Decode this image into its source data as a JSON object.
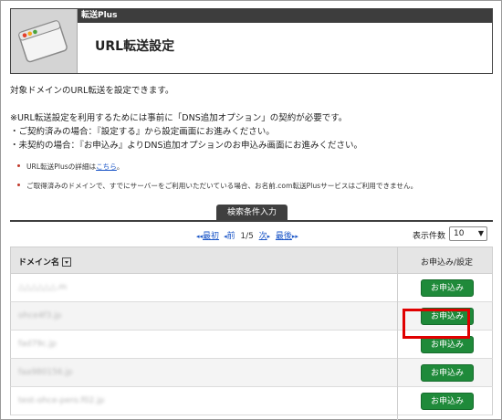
{
  "header": {
    "service_name": "転送Plus",
    "title": "URL転送設定"
  },
  "intro": "対象ドメインのURL転送を設定できます。",
  "requirement": {
    "line1": "※URL転送設定を利用するためには事前に「DNS追加オプション」の契約が必要です。",
    "line2": "・ご契約済みの場合：『設定する』から設定画面にお進みください。",
    "line3": "・未契約の場合：『お申込み』よりDNS追加オプションのお申込み画面にお進みください。"
  },
  "notes": {
    "note1_prefix": "URL転送Plusの詳細は",
    "note1_link": "こちら",
    "note1_suffix": "。",
    "note2": "ご取得済みのドメインで、すでにサーバーをご利用いただいている場合、お名前.com転送Plusサービスはご利用できません。"
  },
  "search_tab": "検索条件入力",
  "pager": {
    "first": "最初",
    "prev": "前",
    "page": "1/5",
    "next": "次",
    "last": "最後"
  },
  "count": {
    "label": "表示件数",
    "value": "10"
  },
  "table": {
    "col_domain": "ドメイン名",
    "col_apply": "お申込み/設定",
    "rows": [
      {
        "domain": "△△△△△△.m",
        "button": "お申込み"
      },
      {
        "domain": "ohce4f3.jp",
        "button": "お申込み"
      },
      {
        "domain": "fad79c.jp",
        "button": "お申込み"
      },
      {
        "domain": "faa980156.jp",
        "button": "お申込み"
      },
      {
        "domain": "test-ohce-pero.f02.jp",
        "button": "お申込み"
      }
    ]
  },
  "colors": {
    "apply_button": "#1f8a3a",
    "highlight": "#e00000",
    "header_bar": "#3d3d3d"
  }
}
